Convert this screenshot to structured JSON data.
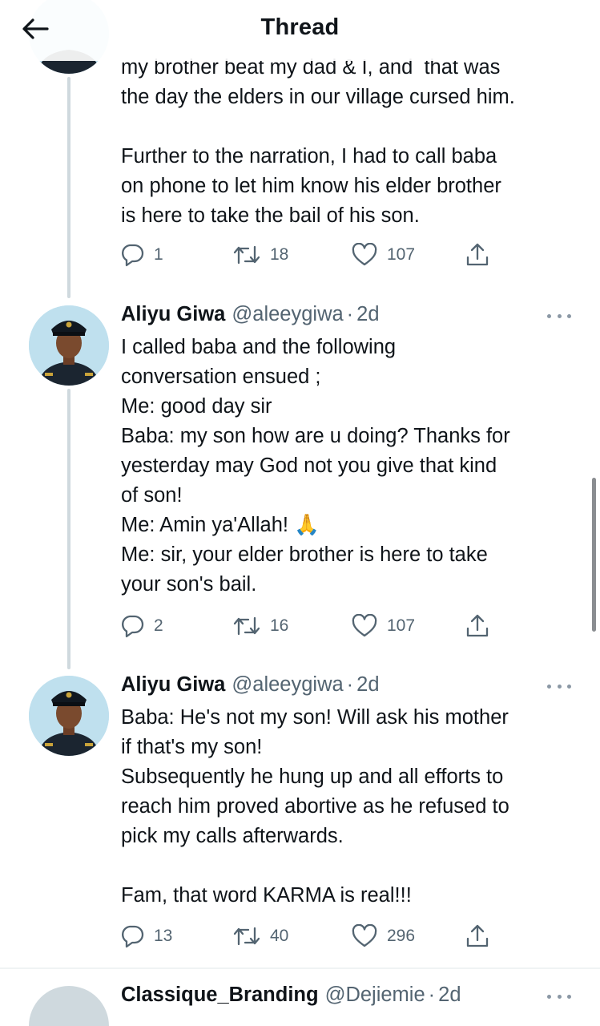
{
  "header": {
    "title": "Thread"
  },
  "tweet_prev": {
    "text": "my brother beat my dad & I, and  that was\nthe day the elders in our village cursed him.\n\nFurther to the narration, I had to call baba\non phone to let him know his elder brother\nis here to take the bail of his son.",
    "replies": "1",
    "retweets": "18",
    "likes": "107"
  },
  "tweet2": {
    "name": "Aliyu Giwa",
    "handle": "@aleeygiwa",
    "time": "2d",
    "text_before_emoji": "I called baba and the following\nconversation ensued ;\nMe: good day sir\nBaba: my son how are u doing? Thanks for\nyesterday may God not you give that kind\nof son!\nMe: Amin ya'Allah! ",
    "emoji": "🙏",
    "text_after_emoji": "\nMe: sir, your elder brother is here to take\nyour son's bail.",
    "replies": "2",
    "retweets": "16",
    "likes": "107"
  },
  "tweet3": {
    "name": "Aliyu Giwa",
    "handle": "@aleeygiwa",
    "time": "2d",
    "text": "Baba: He's not my son! Will ask his mother\nif that's my son!\nSubsequently he hung up and all efforts to\nreach him proved abortive as he refused to\npick my calls afterwards.\n\nFam, that word KARMA is real!!!",
    "replies": "13",
    "retweets": "40",
    "likes": "296"
  },
  "tweet4": {
    "name": "Classique_Branding",
    "handle": "@Dejiemie",
    "time": "2d"
  },
  "icons": {
    "back": "arrow-left-icon",
    "reply": "reply-bubble-icon",
    "retweet": "retweet-icon",
    "like": "heart-icon",
    "share": "share-icon",
    "more": "more-dots-icon"
  },
  "colors": {
    "text": "#0f1419",
    "secondary": "#536471",
    "thread_line": "#cfd9de"
  }
}
